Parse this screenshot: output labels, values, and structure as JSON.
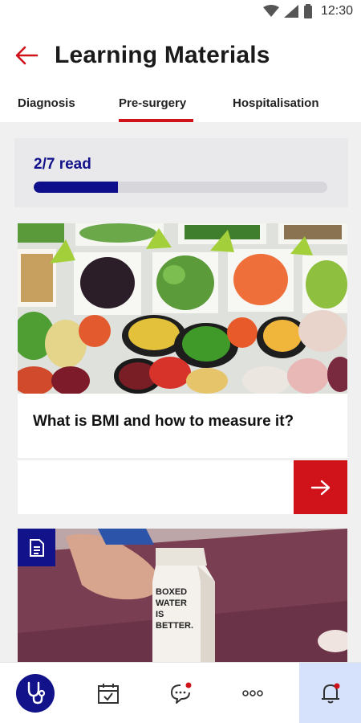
{
  "status_bar": {
    "time": "12:30",
    "icons": [
      "wifi-icon",
      "signal-icon",
      "battery-icon"
    ]
  },
  "header": {
    "back_icon": "arrow-left-icon",
    "title": "Learning Materials"
  },
  "tabs": [
    {
      "label": "Diagnosis",
      "selected": false
    },
    {
      "label": "Pre-surgery",
      "selected": true
    },
    {
      "label": "Hospitalisation",
      "selected": false
    }
  ],
  "progress": {
    "text": "2/7 read",
    "read": 2,
    "total": 7
  },
  "articles": [
    {
      "title": "What is BMI and how to measure it?",
      "image": "vegetable-platters-photo"
    },
    {
      "title": "",
      "image": "yoga-mat-water-carton-photo",
      "badge_icon": "document-icon",
      "carton_text": "BOXED WATER IS BETTER."
    }
  ],
  "action": {
    "icon": "arrow-right-icon"
  },
  "bottom_nav": [
    {
      "name": "stethoscope",
      "icon": "stethoscope-icon",
      "active": true
    },
    {
      "name": "calendar",
      "icon": "calendar-check-icon",
      "active": false
    },
    {
      "name": "messages",
      "icon": "chat-bubble-icon",
      "active": false,
      "notification_dot": true
    },
    {
      "name": "more",
      "icon": "more-dots-icon",
      "active": false
    },
    {
      "name": "notifications",
      "icon": "bell-icon",
      "active": false,
      "notification_dot": true
    }
  ],
  "colors": {
    "accent_red": "#d0121b",
    "brand_navy": "#12128a",
    "progress_track": "#d7d7db",
    "active_nav_bg": "#d6e2fb"
  }
}
